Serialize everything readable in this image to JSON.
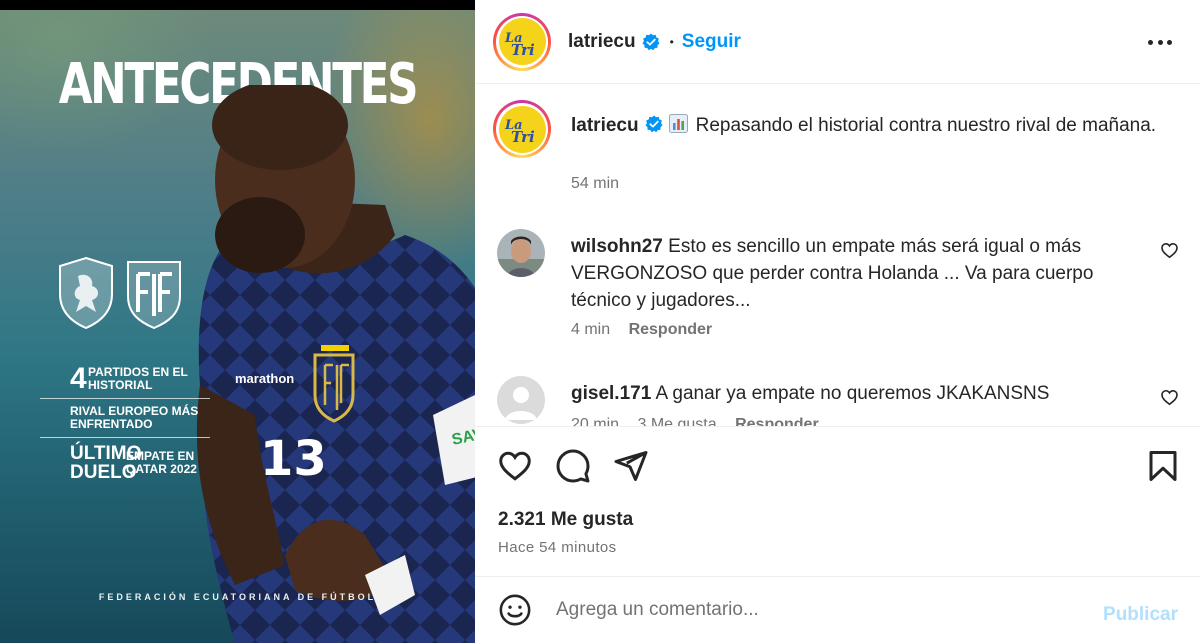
{
  "media": {
    "title": "ANTECEDENTES",
    "stats": [
      {
        "number": "4",
        "text": "PARTIDOS EN EL HISTORIAL"
      },
      {
        "text": "RIVAL EUROPEO MÁS ENFRENTADO"
      },
      {
        "big": "ÚLTIMO DUELO",
        "text": "EMPATE EN QATAR 2022"
      }
    ],
    "footer": "FEDERACIÓN ECUATORIANA DE FÚTBOL",
    "jersey_number": "13",
    "sponsor": "marathon"
  },
  "header": {
    "username": "latriecu",
    "separator": "•",
    "follow_label": "Seguir"
  },
  "caption": {
    "username": "latriecu",
    "text": "Repasando el historial contra nuestro rival de mañana.",
    "time": "54 min"
  },
  "comments": [
    {
      "username": "wilsohn27",
      "text": "Esto es sencillo un empate más será igual o más VERGONZOSO que perder contra Holanda ... Va para cuerpo técnico y jugadores...",
      "time": "4 min",
      "reply_label": "Responder"
    },
    {
      "username": "gisel.171",
      "text": "A ganar ya empate no queremos JKAKANSNS",
      "time": "20 min",
      "likes": "3 Me gusta",
      "reply_label": "Responder"
    }
  ],
  "post": {
    "likes": "2.321 Me gusta",
    "posted_ago": "Hace 54 minutos"
  },
  "composer": {
    "placeholder": "Agrega un comentario...",
    "publish_label": "Publicar"
  },
  "colors": {
    "accent": "#0095f6",
    "publish_disabled": "#b2dffc",
    "muted_text": "#737373",
    "logo_yellow": "#f5d31a"
  },
  "icons": [
    "more-options-icon",
    "verified-badge-icon",
    "heart-icon",
    "comment-icon",
    "share-icon",
    "bookmark-icon",
    "emoji-icon",
    "chart-emoji-icon"
  ]
}
